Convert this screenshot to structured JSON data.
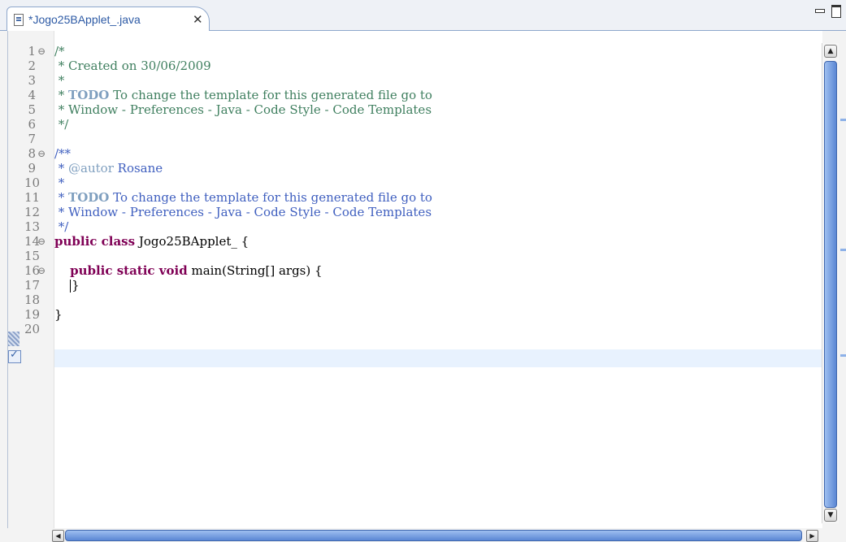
{
  "tab": {
    "title": "*Jogo25BApplet_.java",
    "close_icon": "close-icon",
    "file_icon": "java-file-icon"
  },
  "view_controls": {
    "minimize_icon": "minimize-icon",
    "maximize_icon": "maximize-icon"
  },
  "editor": {
    "line_numbers": [
      "1",
      "2",
      "3",
      "4",
      "5",
      "6",
      "7",
      "8",
      "9",
      "10",
      "11",
      "12",
      "13",
      "14",
      "15",
      "16",
      "17",
      "18",
      "19",
      "20"
    ],
    "folded_lines": [
      "1",
      "8",
      "14",
      "16"
    ],
    "current_line": "17",
    "lines": [
      {
        "num": "1",
        "segments": [
          {
            "t": "/*",
            "k": "c-comment"
          }
        ]
      },
      {
        "num": "2",
        "segments": [
          {
            "t": " * Created on 30/06/2009",
            "k": "c-comment"
          }
        ]
      },
      {
        "num": "3",
        "segments": [
          {
            "t": " *",
            "k": "c-comment"
          }
        ]
      },
      {
        "num": "4",
        "segments": [
          {
            "t": " * ",
            "k": "c-comment"
          },
          {
            "t": "TODO",
            "k": "c-todo"
          },
          {
            "t": " To change the template for this generated file go to",
            "k": "c-comment"
          }
        ]
      },
      {
        "num": "5",
        "segments": [
          {
            "t": " * Window - Preferences - Java - Code Style - Code Templates",
            "k": "c-comment"
          }
        ]
      },
      {
        "num": "6",
        "segments": [
          {
            "t": " */",
            "k": "c-comment"
          }
        ]
      },
      {
        "num": "7",
        "segments": []
      },
      {
        "num": "8",
        "segments": [
          {
            "t": "/**",
            "k": "c-doc"
          }
        ]
      },
      {
        "num": "9",
        "segments": [
          {
            "t": " * ",
            "k": "c-doc"
          },
          {
            "t": "@autor",
            "k": "c-tag"
          },
          {
            "t": " Rosane",
            "k": "c-doc"
          }
        ]
      },
      {
        "num": "10",
        "segments": [
          {
            "t": " *",
            "k": "c-doc"
          }
        ]
      },
      {
        "num": "11",
        "segments": [
          {
            "t": " * ",
            "k": "c-doc"
          },
          {
            "t": "TODO",
            "k": "c-todo"
          },
          {
            "t": " To change the template for this generated file go to",
            "k": "c-doc"
          }
        ]
      },
      {
        "num": "12",
        "segments": [
          {
            "t": " * Window - Preferences - Java - Code Style - Code Templates",
            "k": "c-doc"
          }
        ]
      },
      {
        "num": "13",
        "segments": [
          {
            "t": " */",
            "k": "c-doc"
          }
        ]
      },
      {
        "num": "14",
        "segments": [
          {
            "t": "public class",
            "k": "c-kw"
          },
          {
            "t": " Jogo25BApplet_ {",
            "k": ""
          }
        ]
      },
      {
        "num": "15",
        "segments": []
      },
      {
        "num": "16",
        "segments": [
          {
            "t": "    ",
            "k": ""
          },
          {
            "t": "public static void",
            "k": "c-kw"
          },
          {
            "t": " main(String[] args) {",
            "k": ""
          }
        ]
      },
      {
        "num": "17",
        "segments": [
          {
            "t": "    ",
            "k": ""
          },
          {
            "t": "CARET",
            "k": "caret"
          },
          {
            "t": "}",
            "k": ""
          }
        ]
      },
      {
        "num": "18",
        "segments": []
      },
      {
        "num": "19",
        "segments": [
          {
            "t": "}",
            "k": ""
          }
        ]
      },
      {
        "num": "20",
        "segments": []
      }
    ]
  },
  "scrollbars": {
    "up_arrow": "▲",
    "down_arrow": "▼",
    "left_arrow": "◀",
    "right_arrow": "▶"
  },
  "colors": {
    "comment": "#3f7f5f",
    "javadoc": "#3f5fbf",
    "keyword": "#7f0055",
    "current_line": "#e8f2fe",
    "tab_text": "#2d5aa5"
  }
}
